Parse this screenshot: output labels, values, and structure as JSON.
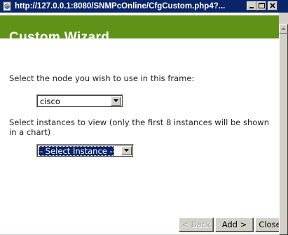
{
  "window": {
    "title": "http://127.0.0.1:8080/SNMPcOnline/CfgCustom.php4?..."
  },
  "header": {
    "title": "Custom Wizard",
    "color": "#5f9318"
  },
  "form": {
    "node_label": "Select the node you wish to use in this frame:",
    "node_value": "cisco",
    "instance_label": "Select instances to view (only the first 8 instances will be shown in a chart)",
    "instance_value": "- Select Instance -"
  },
  "buttons": {
    "back": "< Back",
    "add": "Add >",
    "close": "Close"
  },
  "icons": {
    "app": "ie-page-icon",
    "minimize": "minimize-icon",
    "maximize": "maximize-icon",
    "close": "close-icon",
    "dropdown": "chevron-down-icon",
    "scroll_up": "scroll-up-icon"
  }
}
